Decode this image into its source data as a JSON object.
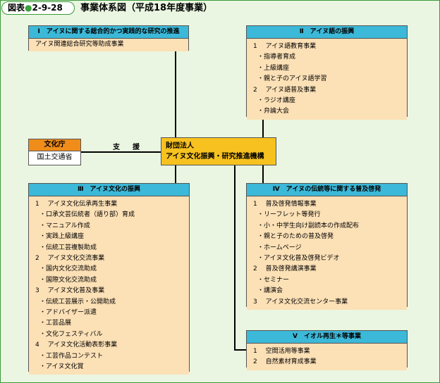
{
  "header": {
    "figure_prefix": "図表",
    "figure_dot": "●",
    "figure_number": "2-9-28",
    "title": "事業体系図（平成18年度事業）"
  },
  "box1": {
    "title": "Ⅰ　アイヌに関する総合的かつ実践的な研究の推進",
    "lines": [
      "アイヌ関連総合研究等助成事業"
    ]
  },
  "box2": {
    "title": "Ⅱ　アイヌ語の振興",
    "lines": [
      "1　 アイヌ語教育事業",
      "・指導者育成",
      "・上級講座",
      "・親と子のアイヌ語学習",
      "2　 アイヌ語普及事業",
      "・ラジオ講座",
      "・弁論大会"
    ]
  },
  "box3": {
    "title": "Ⅲ　アイヌ文化の振興",
    "lines": [
      "1　 アイヌ文化伝承再生事業",
      "・口承文芸伝統者（語り部）育成",
      "・マニュアル作成",
      "・実践上級講座",
      "・伝統工芸複製助成",
      "2　 アイヌ文化交流事業",
      "・国内文化交流助成",
      "・国際文化交流助成",
      "3　 アイヌ文化普及事業",
      "・伝統工芸展示・公開助成",
      "・アドバイザー派遣",
      "・工芸品展",
      "・文化フェスティバル",
      "4　 アイヌ文化活動表彰事業",
      "・工芸作品コンテスト",
      "・アイヌ文化賞"
    ]
  },
  "box4": {
    "title": "Ⅳ　アイヌの伝統等に関する普及啓発",
    "lines": [
      "1　 普及啓発情報事業",
      "・リーフレット等発行",
      "・小・中学生向け副読本の作成配布",
      "・親と子のための普及啓発",
      "・ホームページ",
      "・アイヌ文化普及啓発ビデオ",
      "2　 普及啓発講演事業",
      "・セミナー",
      "・講演会",
      "3　 アイヌ文化交流センター事業"
    ]
  },
  "box5": {
    "title": "Ⅴ　イオル再生＊等事業",
    "lines": [
      "1　 空間活用等事業",
      "2　 自然素材育成事業"
    ]
  },
  "bunkacho": {
    "title": "文化庁",
    "sub": "国土交通省"
  },
  "support_label": "支　援",
  "zaidan": {
    "line1": "財団法人",
    "line2": "アイヌ文化振興・研究推進機構"
  },
  "colors": {
    "header_blue": "#3cb8d8",
    "body_orange": "#fce0b6",
    "center_yellow": "#f7c21f",
    "agency_orange": "#f08c1a",
    "background_green": "#eaf6e1"
  }
}
